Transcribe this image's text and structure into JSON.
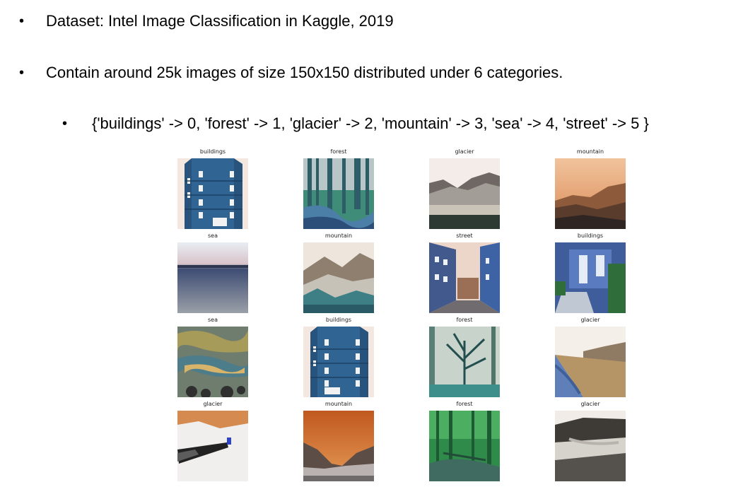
{
  "bullets": {
    "b1": "Dataset: Intel Image Classification in Kaggle, 2019",
    "b2": "Contain around 25k images of size 150x150 distributed under 6 categories.",
    "b3": "{'buildings' -> 0, 'forest' -> 1, 'glacier' -> 2, 'mountain' -> 3, 'sea' -> 4, 'street' -> 5 }"
  },
  "bullet_glyph": "•",
  "grid": {
    "labels": [
      [
        "buildings",
        "forest",
        "glacier",
        "mountain"
      ],
      [
        "sea",
        "mountain",
        "street",
        "buildings"
      ],
      [
        "sea",
        "buildings",
        "forest",
        "glacier"
      ],
      [
        "glacier",
        "mountain",
        "forest",
        "glacier"
      ]
    ]
  }
}
